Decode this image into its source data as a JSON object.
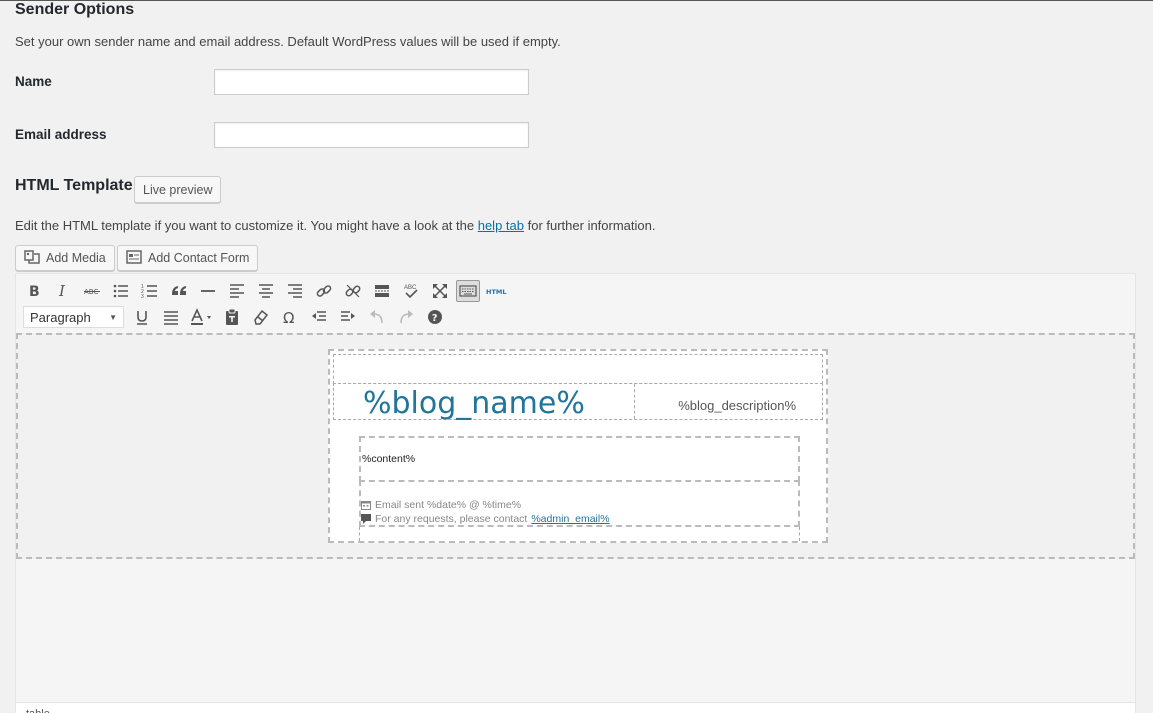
{
  "sender": {
    "title": "Sender Options",
    "description": "Set your own sender name and email address. Default WordPress values will be used if empty.",
    "name_label": "Name",
    "name_value": "",
    "email_label": "Email address",
    "email_value": ""
  },
  "template": {
    "title": "HTML Template",
    "live_preview_label": "Live preview",
    "description_before": "Edit the HTML template if you want to customize it. You might have a look at the ",
    "help_link": "help tab",
    "description_after": " for further information.",
    "add_media_label": "Add Media",
    "add_contact_form_label": "Add Contact Form"
  },
  "editor": {
    "format_select": "Paragraph",
    "html_tag": "HTML",
    "abc_label": "ABC",
    "toolbar_row1": [
      "bold-icon",
      "italic-icon",
      "strikethrough-icon",
      "bullet-list-icon",
      "numbered-list-icon",
      "blockquote-icon",
      "horizontal-rule-icon",
      "align-left-icon",
      "align-center-icon",
      "align-right-icon",
      "link-icon",
      "unlink-icon",
      "read-more-icon",
      "spellcheck-icon",
      "fullscreen-icon",
      "toolbar-toggle-icon",
      "html-icon"
    ],
    "toolbar_row2": [
      "underline-icon",
      "justify-icon",
      "text-color-icon",
      "paste-text-icon",
      "clear-format-icon",
      "special-char-icon",
      "outdent-icon",
      "indent-icon",
      "undo-icon",
      "redo-icon",
      "help-icon"
    ],
    "email": {
      "blog_name": "%blog_name%",
      "blog_description": "%blog_description%",
      "content": "%content%",
      "footer_sent": "Email sent %date% @ %time%",
      "footer_contact": "For any requests, please contact ",
      "admin_email": "%admin_email%"
    },
    "status_path": "table"
  },
  "colors": {
    "link": "#0073aa",
    "blog_name": "#21759b",
    "background": "#f1f1f1"
  }
}
